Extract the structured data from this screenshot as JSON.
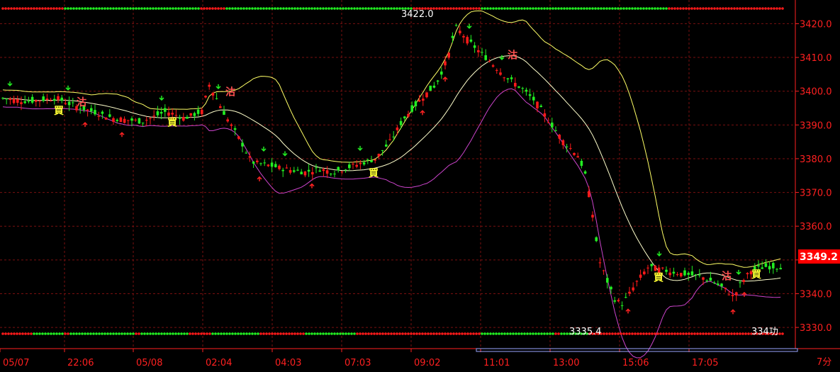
{
  "chart_data": {
    "type": "candlestick",
    "period_label": "7分",
    "x_tick_labels": [
      "05/07",
      "22:06",
      "05/08",
      "02:04",
      "04:03",
      "07:03",
      "09:02",
      "11:01",
      "13:00",
      "15:06",
      "17:05"
    ],
    "y_ticks": [
      3420,
      3410,
      3400,
      3390,
      3380,
      3370,
      3360,
      3350,
      3340,
      3330
    ],
    "y_tick_labels": [
      "3420.0",
      "3410.0",
      "3400.0",
      "3390.0",
      "3380.0",
      "3370.0",
      "3360.0",
      "3350.0",
      "3340.0",
      "3330.0"
    ],
    "ylim": [
      3327.5,
      3424.5
    ],
    "last_price_label": "3349.2",
    "high_annotation": "3422.0",
    "low_annotation": "3335.4",
    "bottom_right_partial_text": "334功",
    "signal_labels": [
      {
        "text": "買",
        "color": "#ffff33"
      },
      {
        "text": "沽",
        "color": "#ff5050"
      },
      {
        "text": "買",
        "color": "#ffff33"
      },
      {
        "text": "沽",
        "color": "#ff5050"
      },
      {
        "text": "買",
        "color": "#ffff33"
      },
      {
        "text": "沽",
        "color": "#ff5050"
      },
      {
        "text": "買",
        "color": "#ffff33"
      },
      {
        "text": "沽",
        "color": "#ff5050"
      },
      {
        "text": "買",
        "color": "#ffff33"
      }
    ],
    "colors": {
      "up": "#ff1a1a",
      "down": "#22ee22",
      "upper_band": "#ffff66",
      "middle_band": "#ffffcc",
      "lower_band": "#cc44cc",
      "grid": "#7a1010",
      "axis_text": "#ff2020",
      "last_price_bg": "#ff0000",
      "buy_arrow": "#22ee22",
      "sell_arrow": "#ff2222"
    }
  }
}
